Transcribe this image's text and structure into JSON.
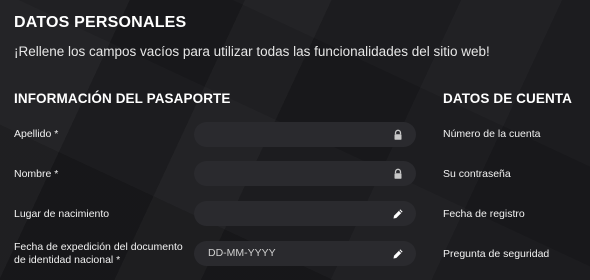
{
  "page": {
    "title": "DATOS PERSONALES",
    "subtitle": "¡Rellene los campos vacíos para utilizar todas las funcionalidades del sitio web!"
  },
  "passport": {
    "title": "INFORMACIÓN DEL PASAPORTE",
    "rows": [
      {
        "label": "Apellido *",
        "value": "",
        "icon": "lock-icon"
      },
      {
        "label": "Nombre *",
        "value": "",
        "icon": "lock-icon"
      },
      {
        "label": "Lugar de nacimiento",
        "value": "",
        "icon": "pencil-icon"
      },
      {
        "label": "Fecha de expedición del documento de identidad nacional *",
        "value": "",
        "placeholder": "DD-MM-YYYY",
        "icon": "pencil-icon"
      }
    ]
  },
  "account": {
    "title": "DATOS DE CUENTA",
    "items": [
      "Número de la cuenta",
      "Su contraseña",
      "Fecha de registro",
      "Pregunta de seguridad"
    ]
  },
  "colors": {
    "background": "#1c1c1f",
    "field": "#2a2a2e",
    "icon": "#c8c8c8"
  }
}
